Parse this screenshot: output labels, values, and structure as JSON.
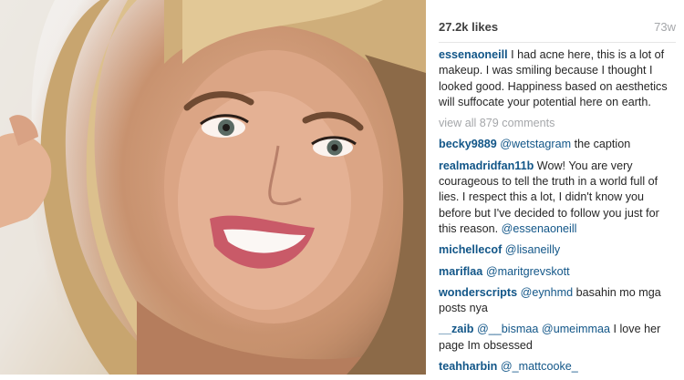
{
  "post": {
    "likes": "27.2k likes",
    "age": "73w",
    "caption": {
      "user": "essenaoneill",
      "text": "I had acne here, this is a lot of makeup. I was smiling because I thought I looked good. Happiness based on aesthetics will suffocate your potential here on earth."
    },
    "view_all": "view all 879 comments",
    "comments": [
      {
        "user": "becky9889",
        "mention": "@wetstagram",
        "text": "the caption"
      },
      {
        "user": "realmadridfan11b",
        "mention": "",
        "text": "Wow! You are very courageous to tell the truth in a world full of lies. I respect this a lot, I didn't know you before but I've decided to follow you just for this reason.",
        "mention_after": "@essenaoneill"
      },
      {
        "user": "michellecof",
        "mention": "@lisaneilly",
        "text": ""
      },
      {
        "user": "mariflaa",
        "mention": "@maritgrevskott",
        "text": ""
      },
      {
        "user": "wonderscripts",
        "mention": "@eynhmd",
        "text": "basahin mo mga posts nya"
      },
      {
        "user": "__zaib",
        "mention": "@__bismaa @umeimmaa",
        "text": "I love her page Im obsessed"
      },
      {
        "user": "teahharbin",
        "mention": "@_mattcooke_",
        "text": ""
      }
    ]
  },
  "colors": {
    "username": "#125688",
    "muted": "#a5a7aa",
    "text": "#262626"
  }
}
